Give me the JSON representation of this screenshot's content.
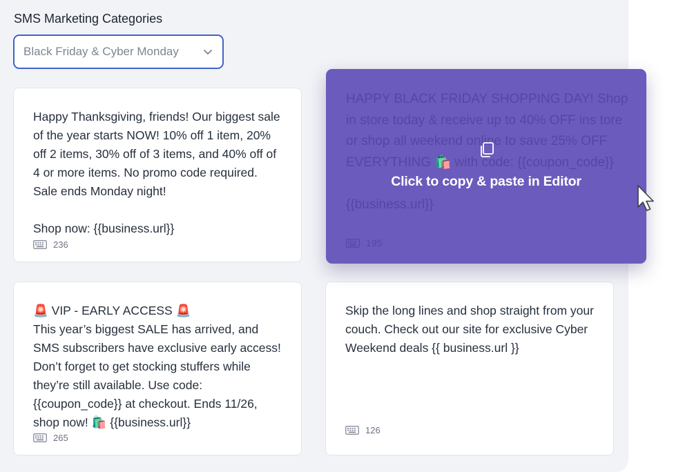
{
  "panel": {
    "title": "SMS Marketing Categories"
  },
  "category_select": {
    "value": "Black Friday & Cyber Monday",
    "icon": "chevron-down-icon"
  },
  "cards": [
    {
      "text": "Happy Thanksgiving, friends! Our biggest sale of the year starts NOW! 10% off 1 item, 20% off 2 items, 30% off of 3 items, and 40% off of 4 or more items. No promo code required. Sale ends Monday night!\n\nShop now: {{business.url}}",
      "count": "236"
    },
    {
      "text": "HAPPY BLACK FRIDAY SHOPPING DAY! Shop in store today & receive up to 40% OFF ins tore or shop all weekend online to save 25% OFF EVERYTHING 🛍️ with code: {{coupon_code}}\n\n{{business.url}}",
      "count": "195",
      "hover_label": "Click to copy & paste in Editor",
      "hover_icon": "copy-icon"
    },
    {
      "text": "🚨 VIP - EARLY ACCESS 🚨\nThis year’s biggest SALE has arrived, and SMS subscribers have exclusive early access! Don’t forget to get stocking stuffers while they’re still available. Use code: {{coupon_code}} at checkout. Ends 11/26, shop now! 🛍️ {{business.url}}",
      "count": "265"
    },
    {
      "text": "Skip the long lines and shop straight from your couch. Check out our site for exclusive Cyber Weekend deals {{ business.url }}",
      "count": "126"
    }
  ],
  "colors": {
    "panel_bg": "#f2f3f7",
    "select_border": "#3f63c8",
    "hover_card_bg": "#6a5bbd"
  }
}
